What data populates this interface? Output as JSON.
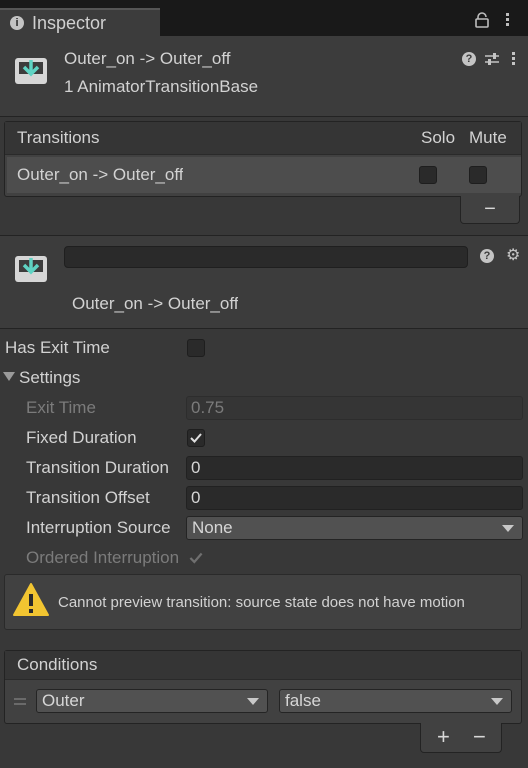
{
  "tab": {
    "title": "Inspector"
  },
  "header": {
    "title": "Outer_on -> Outer_off",
    "subtitle": "1 AnimatorTransitionBase"
  },
  "transitions": {
    "header": "Transitions",
    "col_solo": "Solo",
    "col_mute": "Mute",
    "rows": [
      {
        "label": "Outer_on -> Outer_off",
        "solo": false,
        "mute": false
      }
    ],
    "remove_label": "−"
  },
  "transition": {
    "name_value": "",
    "subtitle": "Outer_on -> Outer_off"
  },
  "props": {
    "has_exit_time": {
      "label": "Has Exit Time",
      "checked": false
    },
    "settings": {
      "label": "Settings",
      "expanded": true
    },
    "exit_time": {
      "label": "Exit Time",
      "value": "0.75"
    },
    "fixed_duration": {
      "label": "Fixed Duration",
      "checked": true
    },
    "transition_duration": {
      "label": "Transition Duration",
      "value": "0"
    },
    "transition_offset": {
      "label": "Transition Offset",
      "value": "0"
    },
    "interruption_source": {
      "label": "Interruption Source",
      "value": "None"
    },
    "ordered_interruption": {
      "label": "Ordered Interruption",
      "checked": true
    }
  },
  "warning": {
    "text": "Cannot preview transition: source state does not have motion"
  },
  "conditions": {
    "header": "Conditions",
    "rows": [
      {
        "parameter": "Outer",
        "value": "false"
      }
    ],
    "add_label": "+",
    "remove_label": "−"
  },
  "colors": {
    "accent_icon": "#5fd3c3",
    "warning": "#f2c531",
    "check": "#e0e0e0"
  }
}
